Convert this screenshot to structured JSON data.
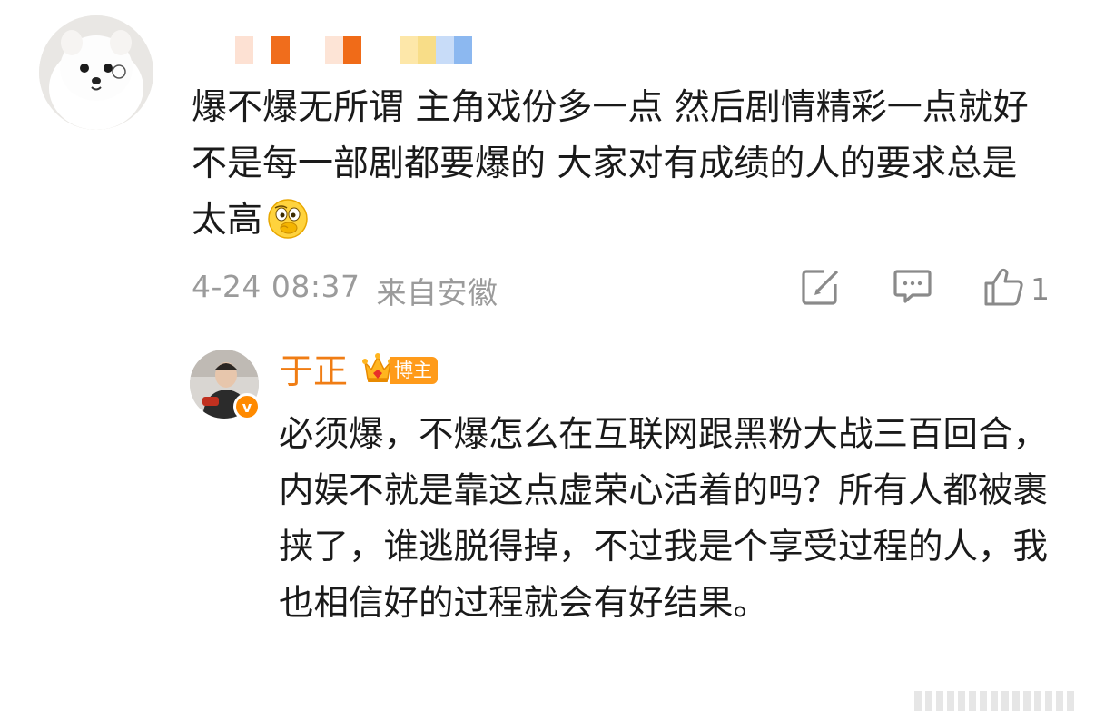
{
  "comment": {
    "text": "爆不爆无所谓 主角戏份多一点 然后剧情精彩一点就好 不是每一部剧都要爆的 大家对有成绩的人的要求总是太高",
    "emoji": "thinking-face-emoji",
    "date": "4-24 08:37",
    "location": "来自安徽",
    "like_count": "1",
    "icons": [
      "share-icon",
      "comment-icon",
      "like-icon"
    ]
  },
  "reply": {
    "author": "于正",
    "badge_label": "博主",
    "verified_mark": "v",
    "text": "必须爆，不爆怎么在互联网跟黑粉大战三百回合，内娱不就是靠这点虚荣心活着的吗？所有人都被裹挟了，谁逃脱得掉，不过我是个享受过程的人，我也相信好的过程就会有好结果。"
  },
  "colors": {
    "name_orange": "#f07d14",
    "badge_orange": "#ff9b1a",
    "meta_gray": "#9b9b9b",
    "text": "#1a1a1a"
  }
}
